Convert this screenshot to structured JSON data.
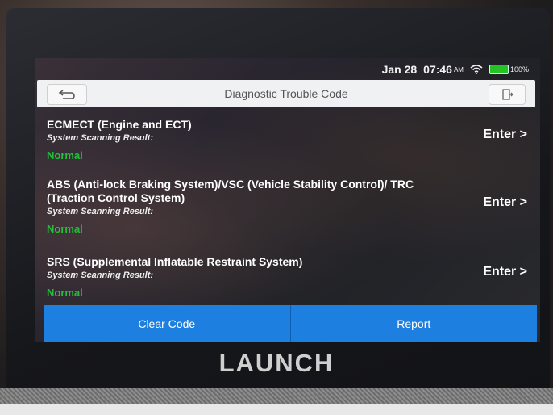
{
  "status_bar": {
    "date": "Jan 28",
    "time": "07:46",
    "ampm": "AM",
    "battery": "100%",
    "battery_color": "#25c425"
  },
  "header": {
    "title": "Diagnostic Trouble Code",
    "back_icon": "back-arrow-icon",
    "exit_icon": "exit-door-icon"
  },
  "systems": [
    {
      "name": "ECMECT (Engine and ECT)",
      "result_label": "System Scanning Result:",
      "result": "Normal",
      "action": "Enter >"
    },
    {
      "name": "ABS (Anti-lock Braking System)/VSC (Vehicle Stability Control)/ TRC (Traction Control System)",
      "result_label": "System Scanning Result:",
      "result": "Normal",
      "action": "Enter >"
    },
    {
      "name": "SRS (Supplemental Inflatable Restraint System)",
      "result_label": "System Scanning Result:",
      "result": "Normal",
      "action": "Enter >"
    }
  ],
  "footer": {
    "clear_code": "Clear Code",
    "report": "Report",
    "button_color": "#1d7fe0"
  },
  "device_brand": "LAUNCH",
  "colors": {
    "normal_status": "#22c03a"
  }
}
